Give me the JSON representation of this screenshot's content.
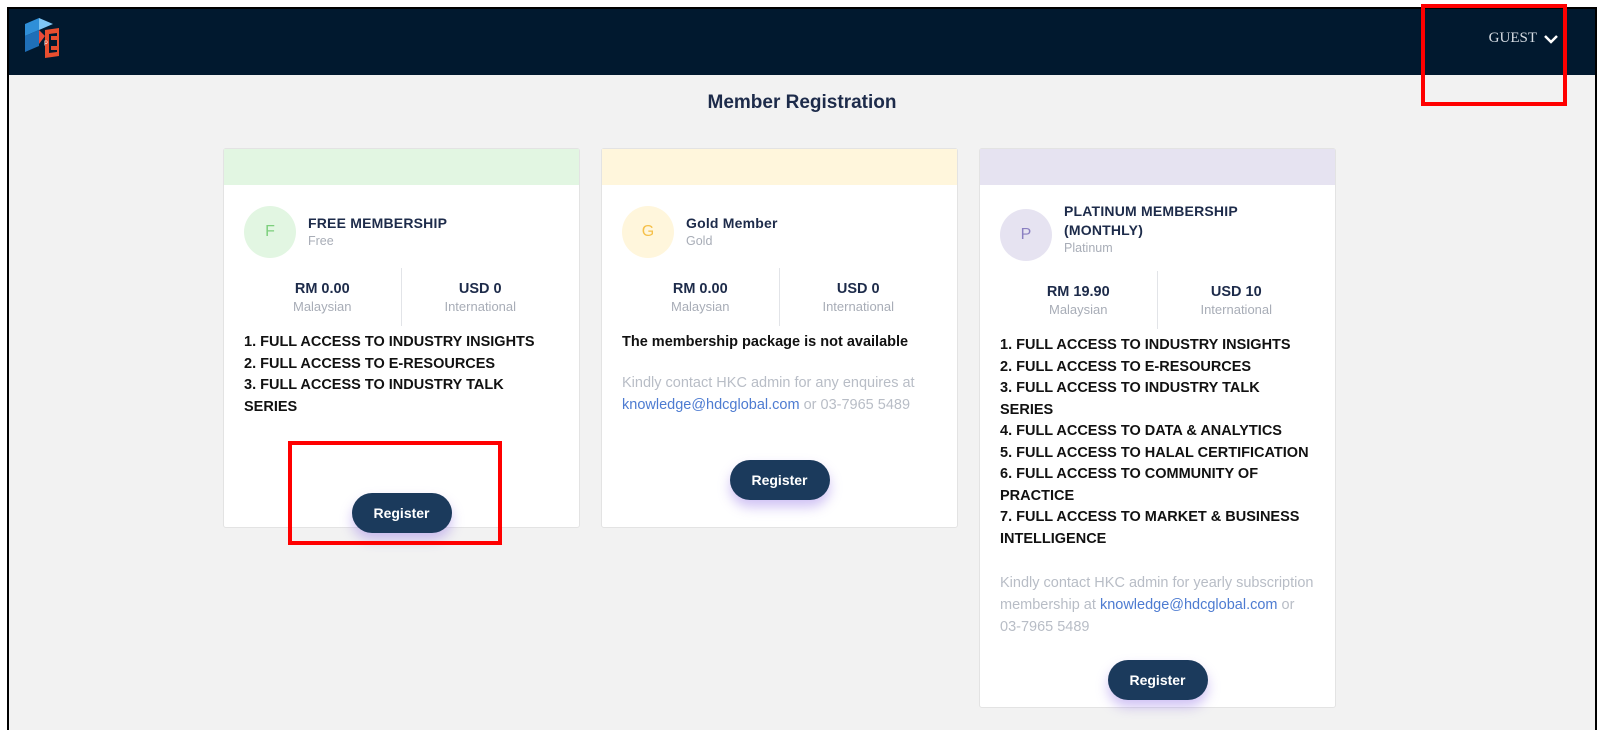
{
  "header": {
    "user_menu_label": "GUEST"
  },
  "page": {
    "title": "Member Registration"
  },
  "colors": {
    "topbar": "#01192f",
    "button": "#1b3a5c",
    "free_accent": "#e2f6e2",
    "gold_accent": "#fff6dc",
    "platinum_accent": "#e6e3f1",
    "link": "#4d7bd1"
  },
  "plans": [
    {
      "initial": "F",
      "name": "FREE MEMBERSHIP",
      "type": "Free",
      "price_local": "RM 0.00",
      "price_local_label": "Malaysian",
      "price_intl": "USD 0",
      "price_intl_label": "International",
      "features": [
        "1.  FULL ACCESS TO INDUSTRY INSIGHTS",
        "2.  FULL ACCESS TO E-RESOURCES",
        "3.  FULL ACCESS TO INDUSTRY TALK SERIES"
      ],
      "button_label": "Register"
    },
    {
      "initial": "G",
      "name": "Gold Member",
      "type": "Gold",
      "price_local": "RM 0.00",
      "price_local_label": "Malaysian",
      "price_intl": "USD 0",
      "price_intl_label": "International",
      "notice": "The membership package is not available",
      "contact_prefix": "Kindly contact HKC admin for any enquires at",
      "contact_email": "knowledge@hdcglobal.com",
      "contact_suffix": "or 03-7965 5489",
      "button_label": "Register"
    },
    {
      "initial": "P",
      "name_line1": "PLATINUM MEMBERSHIP",
      "name_line2": "(MONTHLY)",
      "type": "Platinum",
      "price_local": "RM 19.90",
      "price_local_label": "Malaysian",
      "price_intl": "USD 10",
      "price_intl_label": "International",
      "features": [
        "1.  FULL ACCESS TO INDUSTRY INSIGHTS",
        "2.  FULL ACCESS TO E-RESOURCES",
        "3.  FULL ACCESS TO INDUSTRY TALK SERIES",
        "4.  FULL ACCESS TO DATA & ANALYTICS",
        "5.  FULL ACCESS TO HALAL CERTIFICATION",
        "6.  FULL ACCESS TO COMMUNITY OF PRACTICE",
        "7.  FULL ACCESS TO MARKET & BUSINESS INTELLIGENCE"
      ],
      "contact_prefix": "Kindly contact HKC admin for yearly subscription membership at",
      "contact_email": "knowledge@hdcglobal.com",
      "contact_suffix": "or 03-7965 5489",
      "button_label": "Register"
    }
  ]
}
